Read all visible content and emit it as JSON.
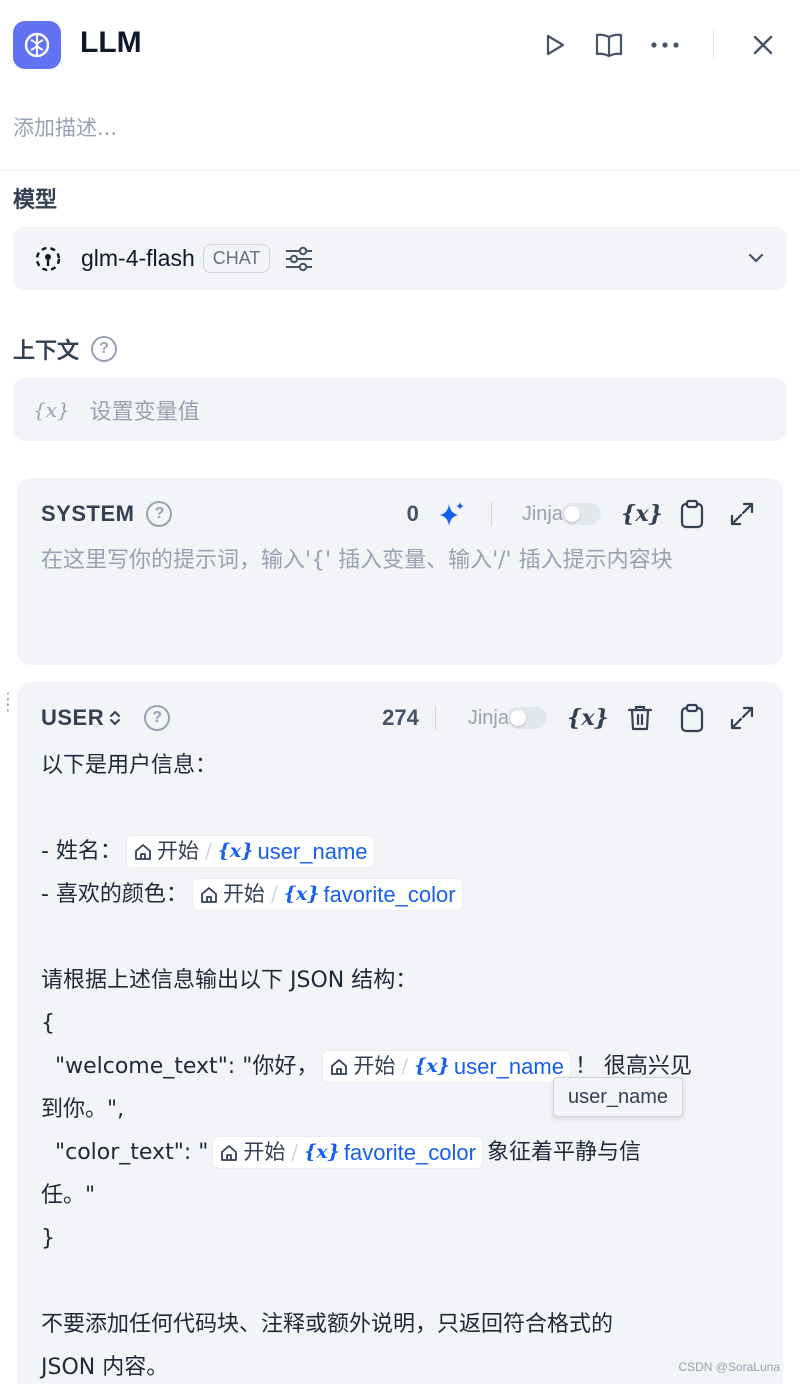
{
  "header": {
    "title": "LLM",
    "description_placeholder": "添加描述...",
    "icons": [
      "brain-node-icon",
      "play-icon",
      "book-icon",
      "more-icon",
      "close-icon"
    ]
  },
  "model": {
    "label": "模型",
    "name": "glm-4-flash",
    "mode_badge": "CHAT"
  },
  "context": {
    "label": "上下文",
    "var_glyph": "{x}",
    "placeholder": "设置变量值"
  },
  "system_prompt": {
    "role": "SYSTEM",
    "count": "0",
    "jinja_label": "Jinja",
    "placeholder": "在这里写你的提示词，输入'{' 插入变量、输入'/' 插入提示内容块"
  },
  "user_prompt": {
    "role": "USER",
    "count": "274",
    "jinja_label": "Jinja",
    "lines": {
      "l1": "以下是用户信息：",
      "l3_prefix": "- 姓名：",
      "l4_prefix": "- 喜欢的颜色：",
      "l6": "请根据上述信息输出以下 JSON 结构：",
      "l7": "{",
      "l8_prefix": "  \"welcome_text\": \"你好，",
      "l8_suffix": "！ 很高兴见",
      "l9": "到你。\",",
      "l10_prefix": "  \"color_text\": \"",
      "l10_suffix": "象征着平静与信",
      "l11": "任。\"",
      "l12": "}",
      "l14": "不要添加任何代码块、注释或额外说明，只返回符合格式的",
      "l15": "JSON 内容。"
    },
    "chip_node": "开始",
    "chip_glyph": "{x}",
    "var_user_name": "user_name",
    "var_favorite_color": "favorite_color"
  },
  "tooltip": "user_name",
  "watermark": "CSDN @SoraLuna",
  "colors": {
    "accent": "#6172f3",
    "variable_blue": "#155eef",
    "card_bg": "#f2f4f7",
    "placeholder_gray": "#98a2b3"
  }
}
